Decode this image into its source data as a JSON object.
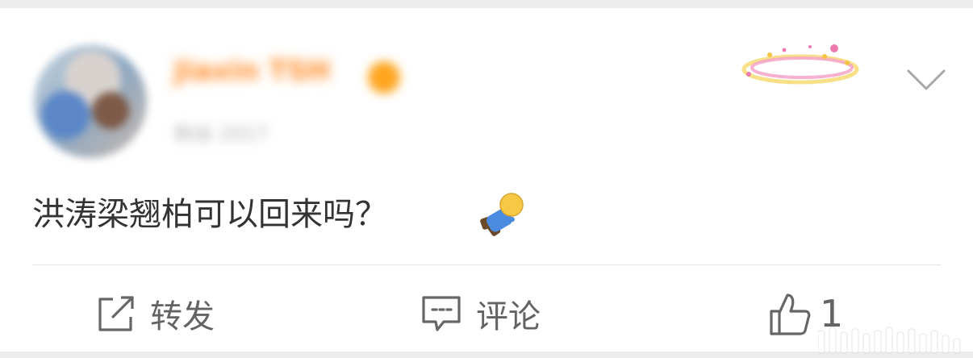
{
  "post": {
    "author_name": "Jiaxin TSH",
    "meta_text": "粉丝 2017",
    "content_text": "洪涛梁翘柏可以回来吗？",
    "emoji_icon": "doge-dead-icon"
  },
  "actions": {
    "repost_label": "转发",
    "comment_label": "评论",
    "like_count": "1"
  },
  "icons": {
    "menu": "chevron-down-icon",
    "repost": "share-box-icon",
    "comment": "speech-bubble-icon",
    "like": "thumbs-up-icon",
    "decoration": "halo-ring-icon"
  },
  "colors": {
    "username_orange": "#ff8a25",
    "text_dark": "#333333",
    "action_gray": "#636363",
    "background": "#ececec"
  }
}
